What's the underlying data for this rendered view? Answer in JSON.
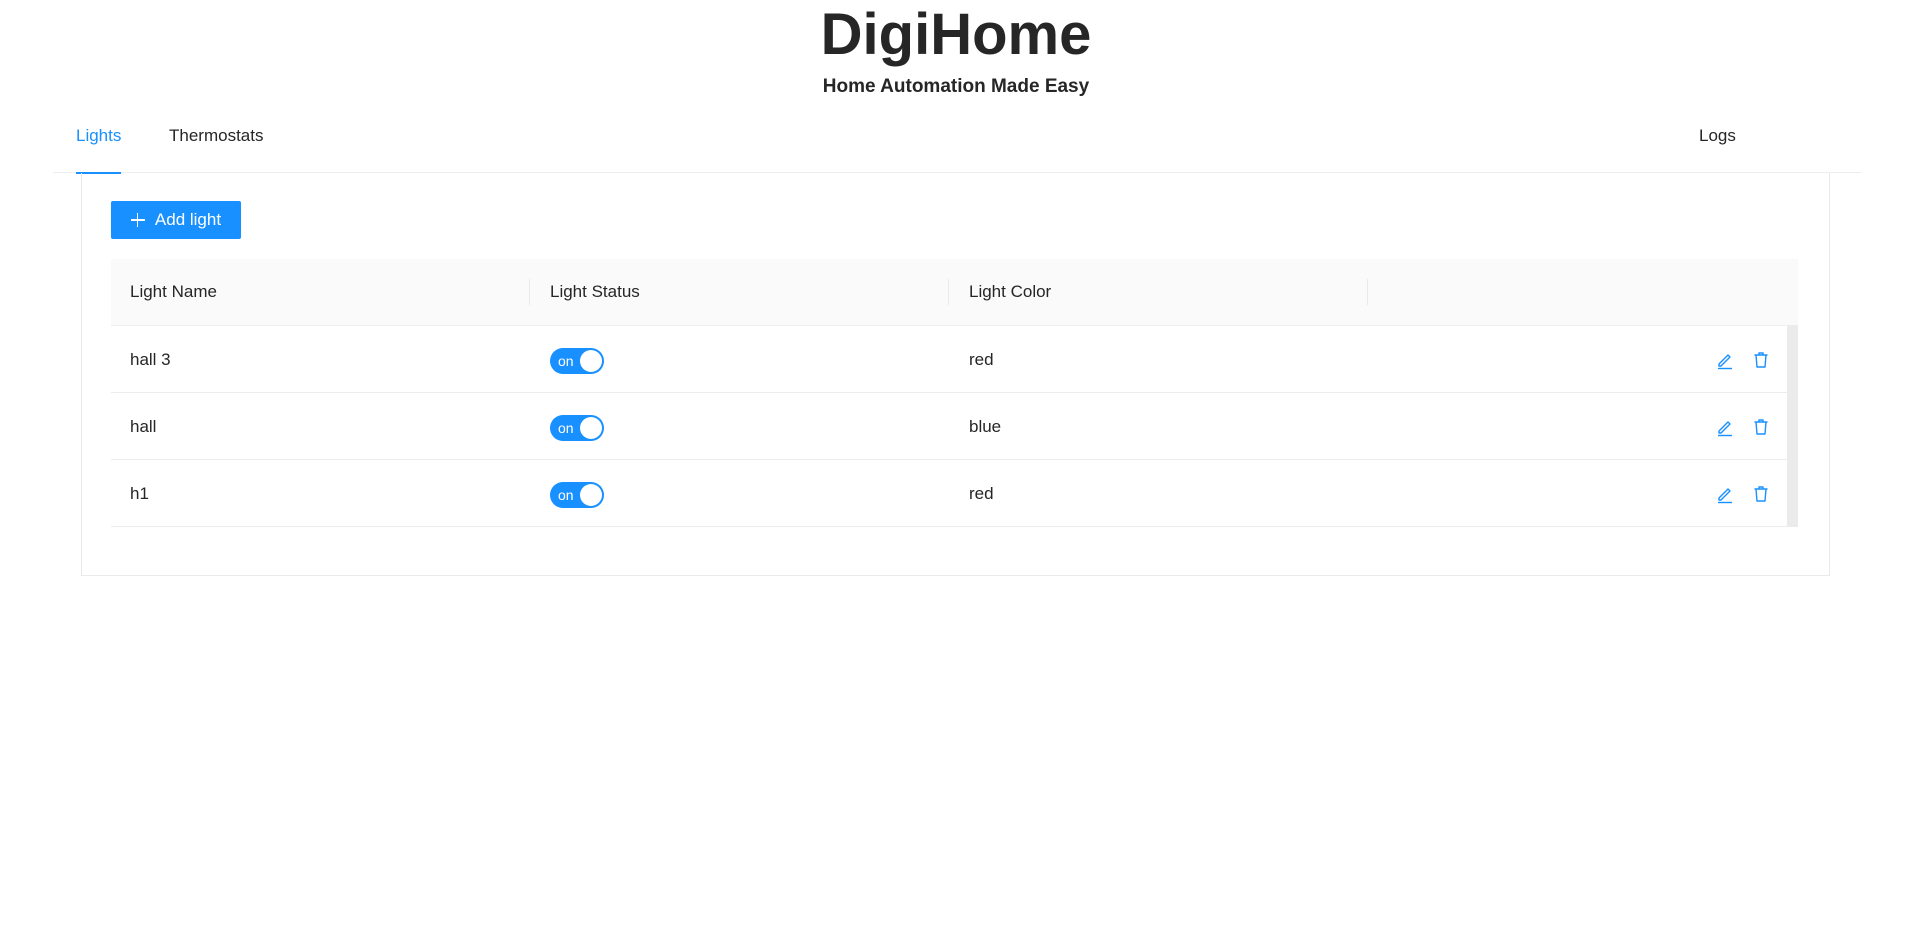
{
  "app": {
    "title": "DigiHome",
    "subtitle": "Home Automation Made Easy"
  },
  "tabs": [
    {
      "label": "Lights",
      "active": true
    },
    {
      "label": "Thermostats",
      "active": false
    },
    {
      "label": "Logs",
      "active": false
    }
  ],
  "toolbar": {
    "add_label": "Add light"
  },
  "table": {
    "columns": [
      "Light Name",
      "Light Status",
      "Light Color",
      ""
    ],
    "rows": [
      {
        "name": "hall 3",
        "status": "on",
        "color": "red"
      },
      {
        "name": "hall",
        "status": "on",
        "color": "blue"
      },
      {
        "name": "h1",
        "status": "on",
        "color": "red"
      }
    ]
  },
  "colors": {
    "accent": "#1890ff",
    "text": "#262626",
    "header_bg": "#fafafa"
  },
  "icons": {
    "add": "plus-icon",
    "edit": "edit-icon",
    "delete": "delete-icon"
  }
}
